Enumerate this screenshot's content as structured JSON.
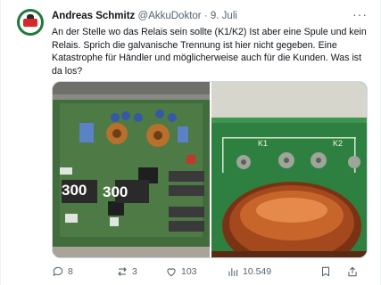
{
  "tweet": {
    "author_name": "Andreas Schmitz",
    "author_handle": "@AkkuDoktor",
    "separator": "·",
    "date": "9. Juli",
    "more_label": "···",
    "text": "An der Stelle wo das Relais sein sollte (K1/K2) Ist aber eine Spule und kein Relais. Sprich die galvanische Trennung ist hier nicht gegeben. Eine Katastrophe für Händler und möglicherweise auch für die Kunden. Was ist da los?"
  },
  "media": {
    "left_photo": {
      "handwritten_labels": [
        "300",
        "300"
      ]
    },
    "right_photo": {
      "board_labels": [
        "K1",
        "K2"
      ]
    }
  },
  "actions": {
    "replies": "8",
    "reposts": "3",
    "likes": "103",
    "views": "10.549"
  },
  "icons": {
    "reply": "reply-icon",
    "repost": "repost-icon",
    "like": "heart-icon",
    "views": "views-icon",
    "bookmark": "bookmark-icon",
    "share": "share-icon"
  },
  "colors": {
    "text": "#0f1419",
    "secondary": "#536471",
    "border": "#cfd9de"
  }
}
